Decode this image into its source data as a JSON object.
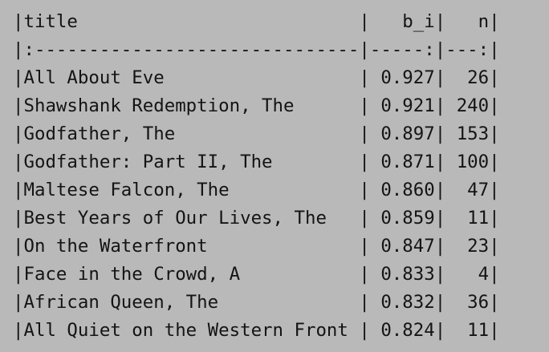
{
  "terminal": {
    "lines": [
      "|title                          |   b_i|   n|",
      "|:------------------------------|-----:|---:|",
      "|All About Eve                  | 0.927|  26|",
      "|Shawshank Redemption, The      | 0.921| 240|",
      "|Godfather, The                 | 0.897| 153|",
      "|Godfather: Part II, The        | 0.871| 100|",
      "|Maltese Falcon, The            | 0.860|  47|",
      "|Best Years of Our Lives, The   | 0.859|  11|",
      "|On the Waterfront              | 0.847|  23|",
      "|Face in the Crowd, A           | 0.833|   4|",
      "|African Queen, The             | 0.832|  36|",
      "|All Quiet on the Western Front | 0.824|  11|"
    ]
  },
  "colors": {
    "background": "#b9b9b9",
    "text": "#141414"
  }
}
